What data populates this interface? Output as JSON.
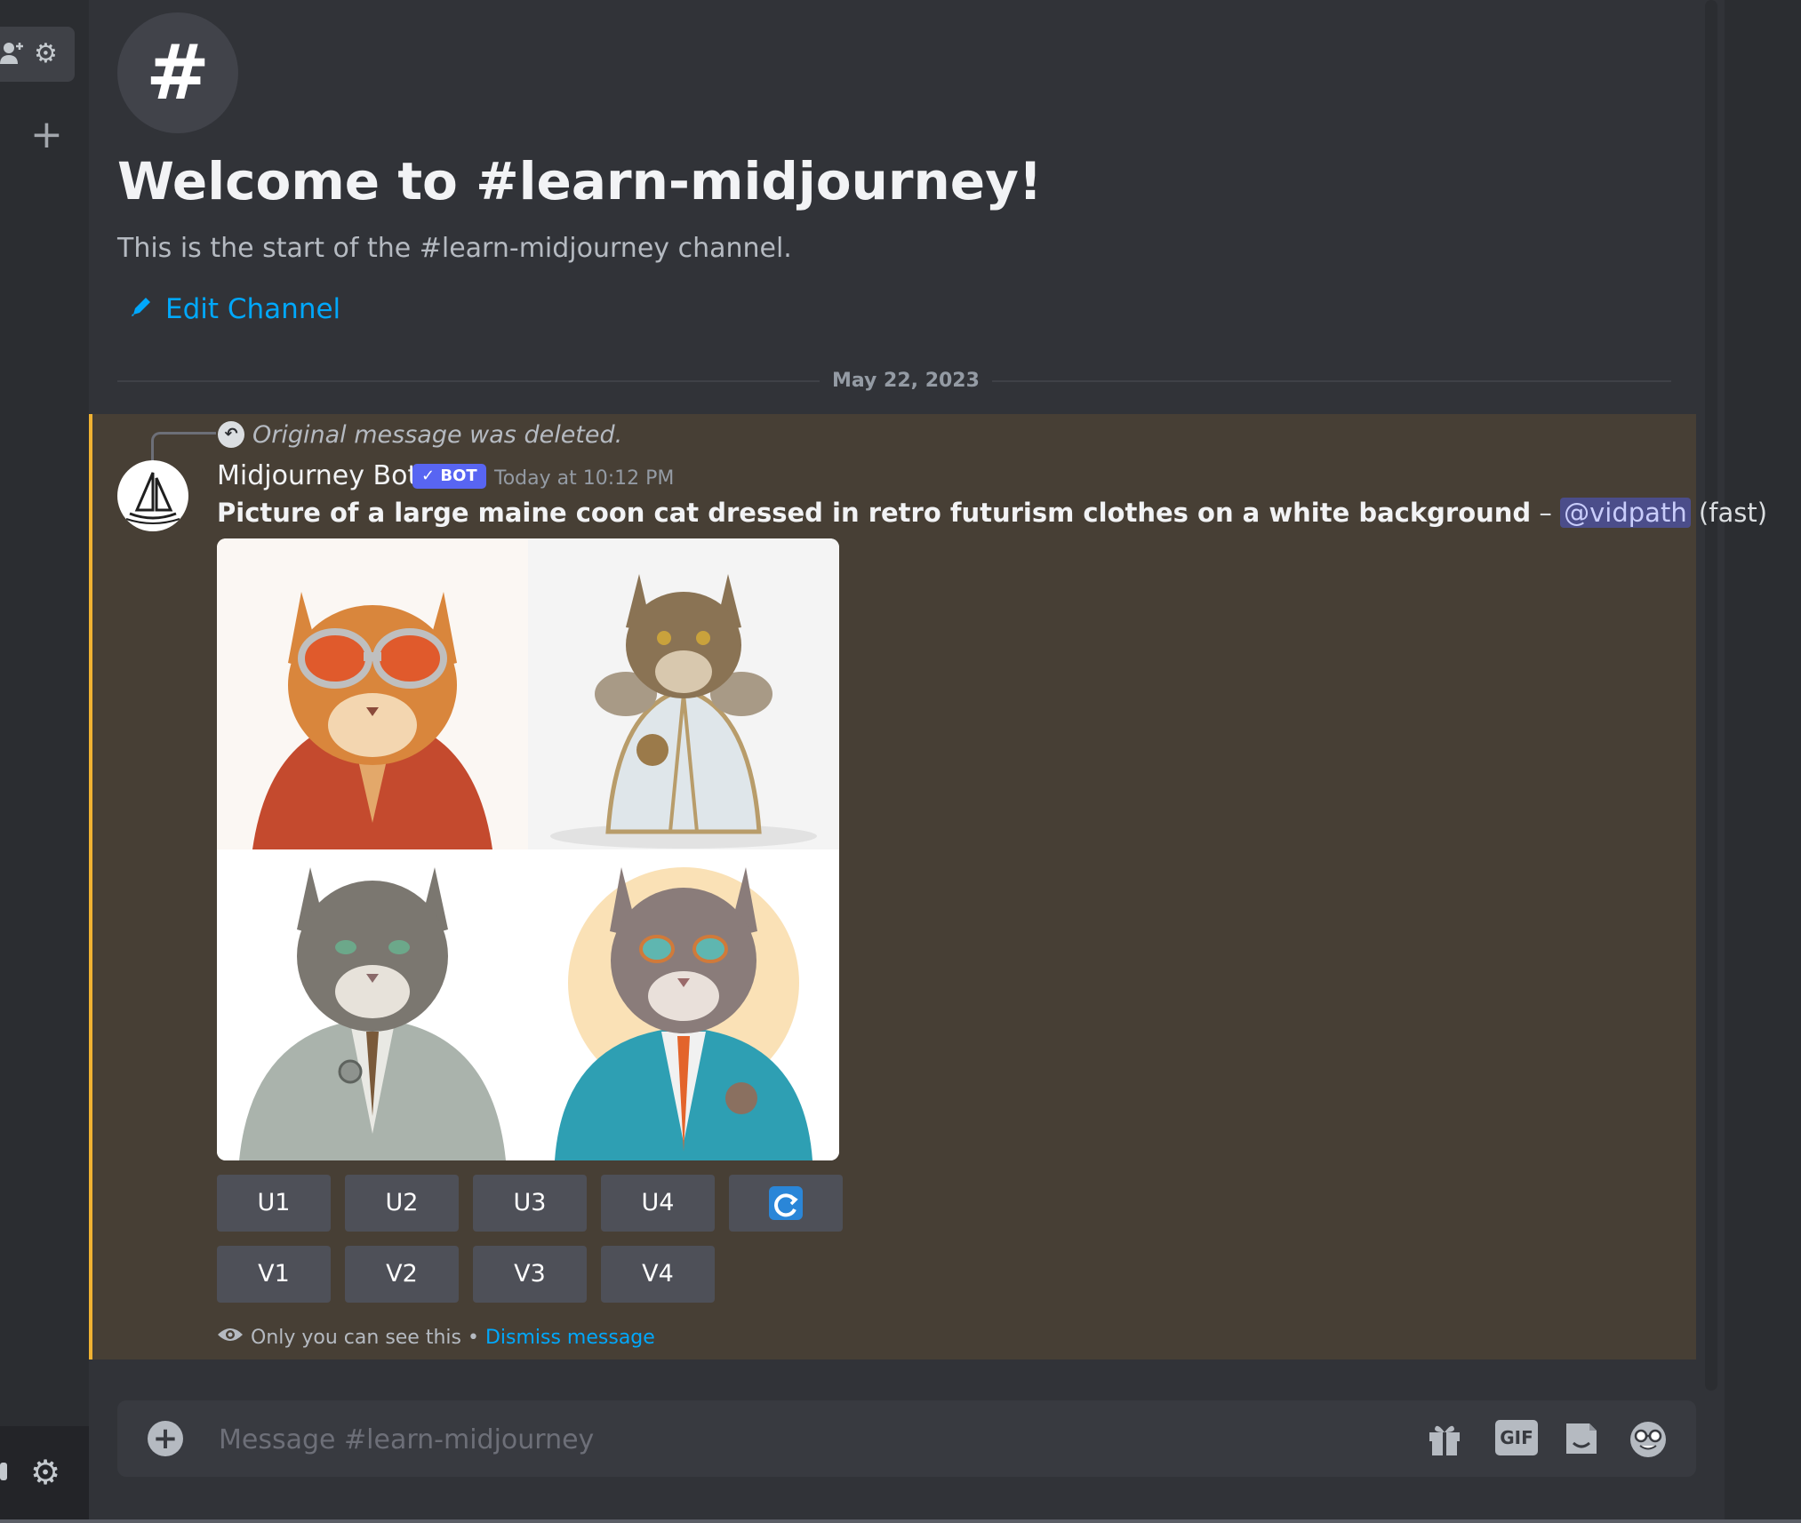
{
  "channel": {
    "name": "learn-midjourney",
    "hash_symbol": "#",
    "welcome_title": "Welcome to #learn-midjourney!",
    "welcome_subtitle": "This is the start of the #learn-midjourney channel.",
    "edit_label": "Edit Channel"
  },
  "date_divider": "May 22, 2023",
  "message": {
    "reply_note": "Original message was deleted.",
    "author": "Midjourney Bot",
    "bot_badge": "✓ BOT",
    "timestamp": "Today at 10:12 PM",
    "prompt": "Picture of a large maine coon cat dressed in retro futurism clothes on a white background",
    "separator": " – ",
    "mention": "@vidpath",
    "mode": "(fast)",
    "images": [
      {
        "name": "cat-goggles-red-jacket",
        "jacket_color": "#c44a2e",
        "fur_color": "#d9863c"
      },
      {
        "name": "cat-white-coat",
        "jacket_color": "#dfe6ea",
        "fur_color": "#8a7354"
      },
      {
        "name": "cat-grey-suit",
        "jacket_color": "#aab3ac",
        "fur_color": "#7b7770"
      },
      {
        "name": "cat-teal-jacket",
        "jacket_color": "#2e9fb3",
        "fur_color": "#8a7c7a"
      }
    ],
    "upscale_buttons": [
      "U1",
      "U2",
      "U3",
      "U4"
    ],
    "variation_buttons": [
      "V1",
      "V2",
      "V3",
      "V4"
    ],
    "refresh_icon": "refresh-icon",
    "ephemeral_text": "Only you can see this •",
    "dismiss_label": "Dismiss message"
  },
  "composer": {
    "placeholder": "Message #learn-midjourney",
    "gif_label": "GIF"
  },
  "colors": {
    "accent_blue": "#00a8fc",
    "highlight_bar": "#f0b232",
    "highlight_bg": "#473f35",
    "bot_badge": "#5865f2"
  }
}
